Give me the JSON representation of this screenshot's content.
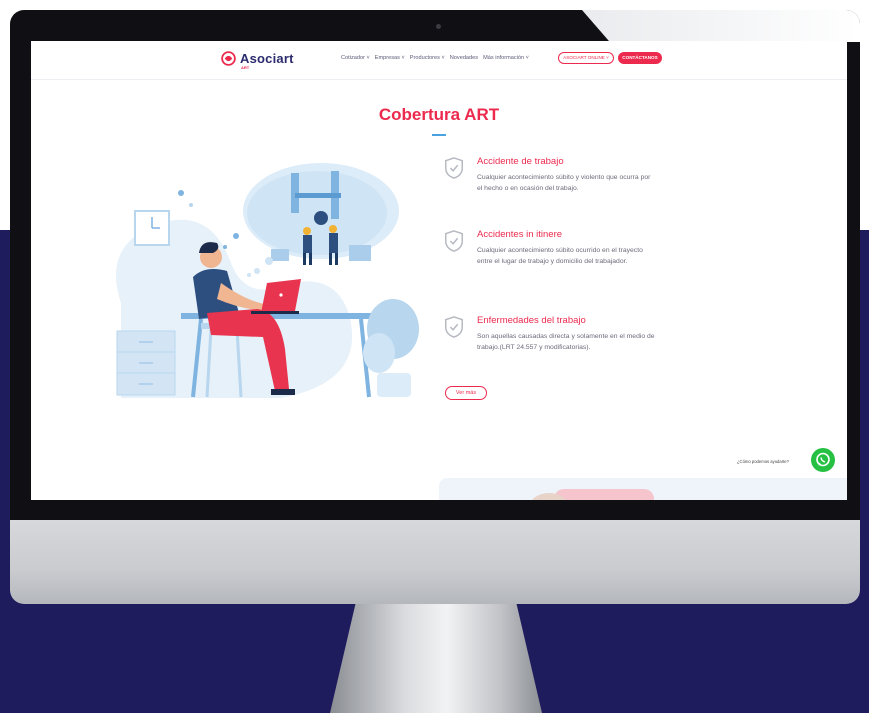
{
  "brand": {
    "name": "Asociart",
    "sub": "ART",
    "primary_color": "#ec2a4e",
    "navy_color": "#2b2b6e",
    "accent_color": "#4aa3e0"
  },
  "nav": {
    "items": [
      "Cotizador ˅",
      "Empresas ˅",
      "Productores ˅",
      "Novedades",
      "Más información ˅"
    ],
    "online_button": "ASOCIART ONLINE ˅",
    "contact_button": "CONTÁCTANOS"
  },
  "section": {
    "title": "Cobertura ART",
    "features": [
      {
        "title": "Accidente de trabajo",
        "desc": "Cualquier acontecimiento súbito y violento que ocurra por el hecho o en ocasión del trabajo.",
        "icon": "shield-check-icon"
      },
      {
        "title": "Accidentes in itinere",
        "desc": "Cualquier acontecimiento súbito ocurrido en el trayecto entre el lugar de trabajo y domicilio del trabajador.",
        "icon": "shield-check-icon"
      },
      {
        "title": "Enfermedades del trabajo",
        "desc": "Son aquellas causadas directa y solamente en el medio de trabajo.(LRT 24.557 y modificatorias).",
        "icon": "shield-check-icon"
      }
    ],
    "more_button": "Ver más"
  },
  "chat": {
    "help_text": "¿Cómo podemos ayudarte?",
    "icon": "whatsapp-icon",
    "color": "#26c043"
  },
  "page": {
    "background_band_color": "#1f1c5e"
  }
}
